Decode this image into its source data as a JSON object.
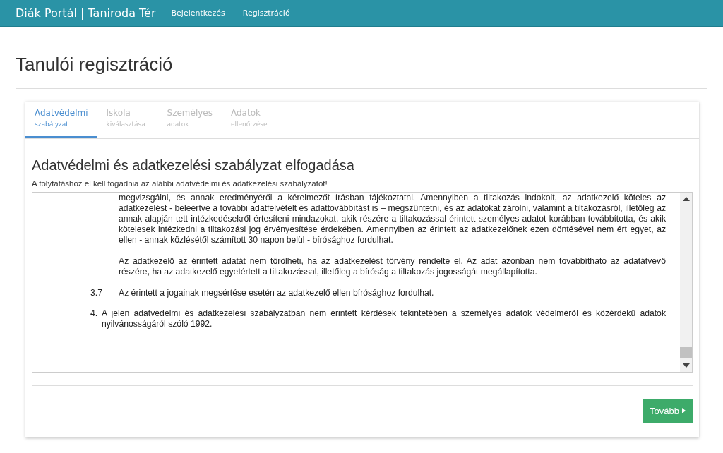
{
  "navbar": {
    "brand": "Diák Portál | Taniroda Tér",
    "links": [
      "Bejelentkezés",
      "Regisztráció"
    ]
  },
  "page_title": "Tanulói regisztráció",
  "tabs": [
    {
      "title": "Adatvédelmi",
      "subtitle": "szabályzat",
      "selected": true
    },
    {
      "title": "Iskola",
      "subtitle": "kiválasztása",
      "selected": false
    },
    {
      "title": "Személyes",
      "subtitle": "adatok",
      "selected": false
    },
    {
      "title": "Adatok",
      "subtitle": "ellenőrzése",
      "selected": false
    }
  ],
  "section_title": "Adatvédelmi és adatkezelési szabályzat elfogadása",
  "instruction": "A folytatáshoz el kell fogadnia az alábbi adatvédelmi és adatkezelési szabályzatot!",
  "document": [
    {
      "kind": "para",
      "text": "megvizsgálni, és annak eredményéről a kérelmezőt írásban tájékoztatni. Amennyiben a tiltakozás indokolt, az adatkezelő köteles az adatkezelést - beleértve a további adatfelvételt és adattovábbítást is – megszüntetni, és az adatokat zárolni, valamint a tiltakozásról, illetőleg az annak alapján tett intézkedésekről értesíteni mindazokat, akik részére a tiltakozással érintett személyes adatot korábban továbbította, és akik kötelesek intézkedni a tiltakozási jog érvényesítése érdekében. Amennyiben az érintett az adatkezelőnek ezen döntésével nem ért egyet, az ellen - annak közlésétől számított 30 napon belül - bírósághoz fordulhat."
    },
    {
      "kind": "para",
      "text": "Az adatkezelő az érintett adatát nem törölheti, ha az adatkezelést törvény rendelte el. Az adat azonban nem továbbítható az adatátvevő részére, ha az adatkezelő egyetértett a tiltakozással, illetőleg a bíróság a tiltakozás jogosságát megállapította."
    },
    {
      "kind": "numbered",
      "number": "3.7",
      "text": "Az érintett a jogainak megsértése esetén az adatkezelő ellen bírósághoz fordulhat."
    },
    {
      "kind": "section",
      "number": "4.",
      "text": "A jelen adatvédelmi és adatkezelési szabályzatban nem érintett kérdések tekintetében a személyes adatok védelméről és közérdekű adatok nyilvánosságáról szóló 1992."
    }
  ],
  "next_button": "Tovább"
}
